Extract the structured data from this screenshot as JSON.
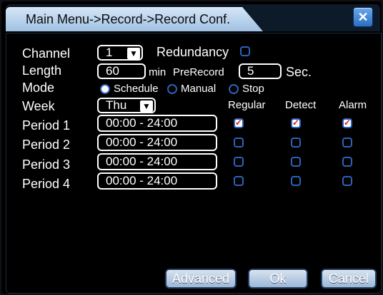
{
  "window": {
    "title": "Main Menu->Record->Record Conf.",
    "close_icon": "close-icon"
  },
  "form": {
    "channel_label": "Channel",
    "channel_value": "1",
    "redundancy_label": "Redundancy",
    "redundancy_checked": false,
    "length_label": "Length",
    "length_value": "60",
    "length_unit": "min",
    "prerecord_label": "PreRecord",
    "prerecord_value": "5",
    "prerecord_unit": "Sec.",
    "mode_label": "Mode",
    "mode_options": [
      "Schedule",
      "Manual",
      "Stop"
    ],
    "mode_selected": "Schedule",
    "week_label": "Week",
    "week_value": "Thu"
  },
  "table": {
    "headers": [
      "Regular",
      "Detect",
      "Alarm"
    ],
    "rows": [
      {
        "label": "Period 1",
        "range": "00:00  -  24:00",
        "regular": true,
        "detect": true,
        "alarm": true
      },
      {
        "label": "Period 2",
        "range": "00:00  -  24:00",
        "regular": false,
        "detect": false,
        "alarm": false
      },
      {
        "label": "Period 3",
        "range": "00:00  -  24:00",
        "regular": false,
        "detect": false,
        "alarm": false
      },
      {
        "label": "Period 4",
        "range": "00:00  -  24:00",
        "regular": false,
        "detect": false,
        "alarm": false
      }
    ]
  },
  "buttons": {
    "advanced": "Advanced",
    "ok": "Ok",
    "cancel": "Cancel"
  },
  "colors": {
    "accent_blue": "#2b63b8",
    "checkmark_red": "#d3131b"
  }
}
